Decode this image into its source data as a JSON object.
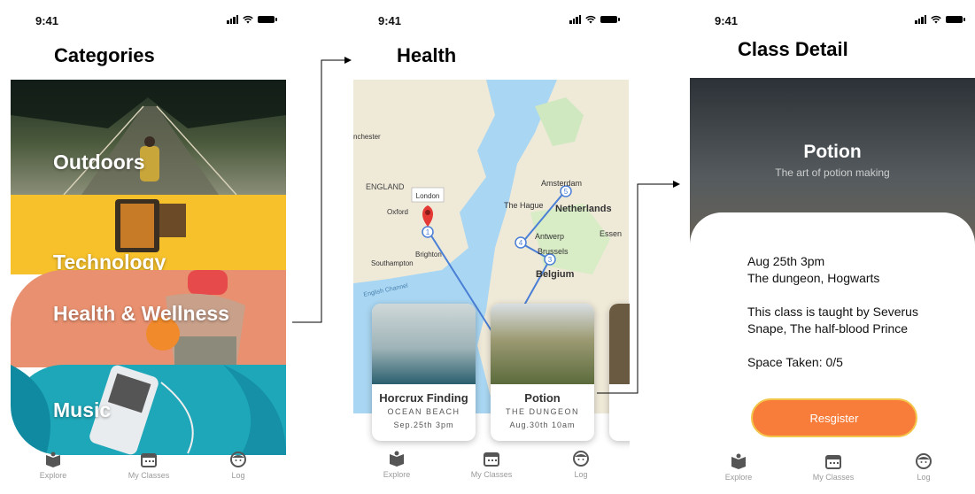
{
  "status": {
    "time": "9:41"
  },
  "screens": {
    "categories": {
      "title": "Categories",
      "items": [
        {
          "label": "Outdoors"
        },
        {
          "label": "Technology"
        },
        {
          "label": "Health & Wellness"
        },
        {
          "label": "Music"
        }
      ]
    },
    "health": {
      "title": "Health",
      "map_label": "London",
      "map_places": [
        "ENGLAND",
        "Oxford",
        "Brighton",
        "Southampton",
        "English Channel",
        "Amsterdam",
        "The Hague",
        "Netherlands",
        "Antwerp",
        "Essen",
        "Brussels",
        "Belgium",
        "nchester"
      ],
      "route_stops": [
        "1",
        "3",
        "4",
        "5"
      ],
      "cards": [
        {
          "name": "Horcrux Finding",
          "location": "OCEAN BEACH",
          "date": "Sep.25th 3pm"
        },
        {
          "name": "Potion",
          "location": "THE DUNGEON",
          "date": "Aug.30th 10am"
        }
      ]
    },
    "detail": {
      "title": "Class Detail",
      "class_name": "Potion",
      "subtitle": "The art of potion making",
      "when": "Aug 25th 3pm",
      "where": "The dungeon, Hogwarts",
      "teacher": "This class is taught by Severus Snape, The half-blood Prince",
      "space": "Space Taken: 0/5",
      "register_label": "Resgister"
    }
  },
  "nav": {
    "explore": "Explore",
    "my_classes": "My Classes",
    "log": "Log"
  },
  "colors": {
    "accent": "#f87d3a",
    "button_border": "#f3c64b",
    "tech_yellow": "#f7c12b",
    "music_teal": "#1ea7b8",
    "health_coral": "#e8906f",
    "route_blue": "#4a7fd6"
  }
}
